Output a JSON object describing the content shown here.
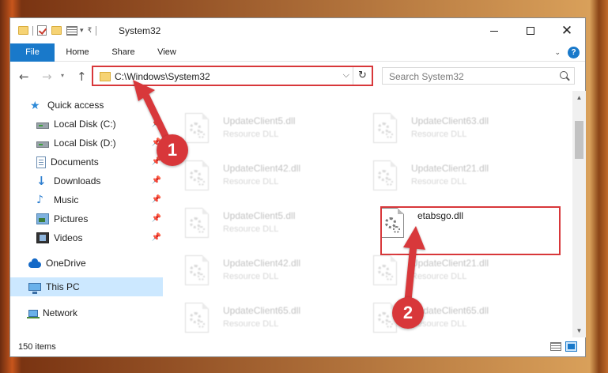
{
  "window": {
    "title": "System32",
    "tabs": [
      "File",
      "Home",
      "Share",
      "View"
    ],
    "help_label": "?"
  },
  "address": {
    "path": "C:\\Windows\\System32",
    "refresh_glyph": "↻"
  },
  "search": {
    "placeholder": "Search System32"
  },
  "navpane": {
    "items": [
      {
        "label": "Quick access",
        "icon": "star-icon",
        "pinned": false
      },
      {
        "label": "Local Disk (C:)",
        "icon": "drive-icon",
        "pinned": true
      },
      {
        "label": "Local Disk (D:)",
        "icon": "drive-icon",
        "pinned": true
      },
      {
        "label": "Documents",
        "icon": "documents-icon",
        "pinned": true
      },
      {
        "label": "Downloads",
        "icon": "download-icon",
        "pinned": true
      },
      {
        "label": "Music",
        "icon": "music-icon",
        "pinned": true
      },
      {
        "label": "Pictures",
        "icon": "pictures-icon",
        "pinned": true
      },
      {
        "label": "Videos",
        "icon": "videos-icon",
        "pinned": true
      },
      {
        "label": "OneDrive",
        "icon": "onedrive-icon",
        "pinned": false
      },
      {
        "label": "This PC",
        "icon": "computer-icon",
        "pinned": false
      },
      {
        "label": "Network",
        "icon": "network-icon",
        "pinned": false
      }
    ]
  },
  "files": [
    {
      "name": "UpdateClient5.dll",
      "type": "Resource DLL",
      "highlighted": false
    },
    {
      "name": "UpdateClient63.dll",
      "type": "Resource DLL",
      "highlighted": false
    },
    {
      "name": "UpdateClient42.dll",
      "type": "Resource DLL",
      "highlighted": false
    },
    {
      "name": "UpdateClient21.dll",
      "type": "Resource DLL",
      "highlighted": false
    },
    {
      "name": "UpdateClient5.dll",
      "type": "Resource DLL",
      "highlighted": false
    },
    {
      "name": "etabsgo.dll",
      "type": "",
      "highlighted": true
    },
    {
      "name": "UpdateClient42.dll",
      "type": "Resource DLL",
      "highlighted": false
    },
    {
      "name": "UpdateClient21.dll",
      "type": "Resource DLL",
      "highlighted": false
    },
    {
      "name": "UpdateClient65.dll",
      "type": "Resource DLL",
      "highlighted": false
    },
    {
      "name": "UpdateClient65.dll",
      "type": "Resource DLL",
      "highlighted": false
    }
  ],
  "status": {
    "item_count": "150 items"
  },
  "annotations": {
    "step1": "1",
    "step2": "2",
    "color": "#d8373a"
  },
  "colors": {
    "accent": "#1979ca",
    "selection": "#cce8ff",
    "highlight": "#d8373a"
  }
}
